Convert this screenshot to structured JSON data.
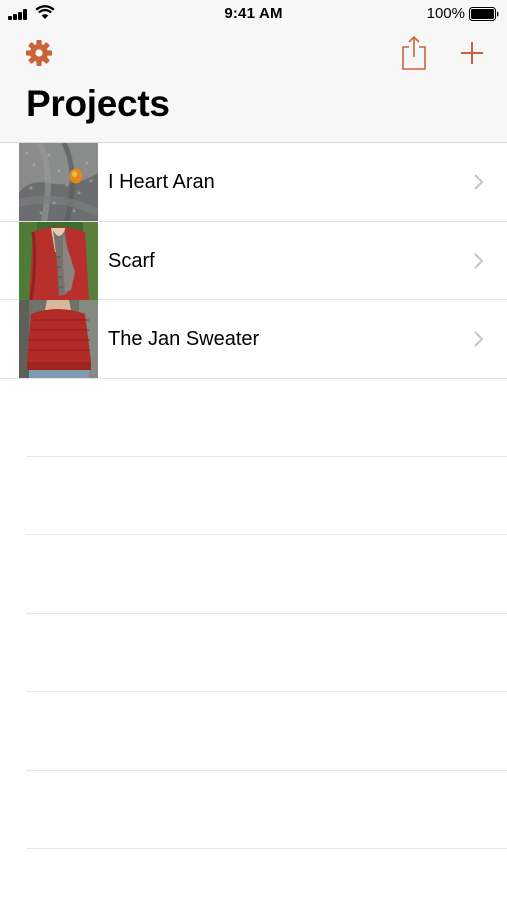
{
  "status_bar": {
    "time": "9:41 AM",
    "battery_percent": "100%",
    "battery_level": 1.0,
    "signal_icon": "cellular-signal-icon",
    "wifi_icon": "wifi-icon",
    "battery_icon": "battery-icon"
  },
  "nav": {
    "title": "Projects",
    "left_icon": "gear-icon",
    "right_icons": [
      "share-icon",
      "plus-icon"
    ]
  },
  "projects": [
    {
      "name": "I Heart Aran",
      "thumbnail": "grey knit shawl with orange button"
    },
    {
      "name": "Scarf",
      "thumbnail": "grey knit scarf over red top"
    },
    {
      "name": "The Jan Sweater",
      "thumbnail": "red knit sweater"
    }
  ],
  "colors": {
    "accent": "#c8643a",
    "nav_background": "#f7f7f7",
    "separator": "#e2e2e2",
    "chevron": "#c4c4c9"
  }
}
